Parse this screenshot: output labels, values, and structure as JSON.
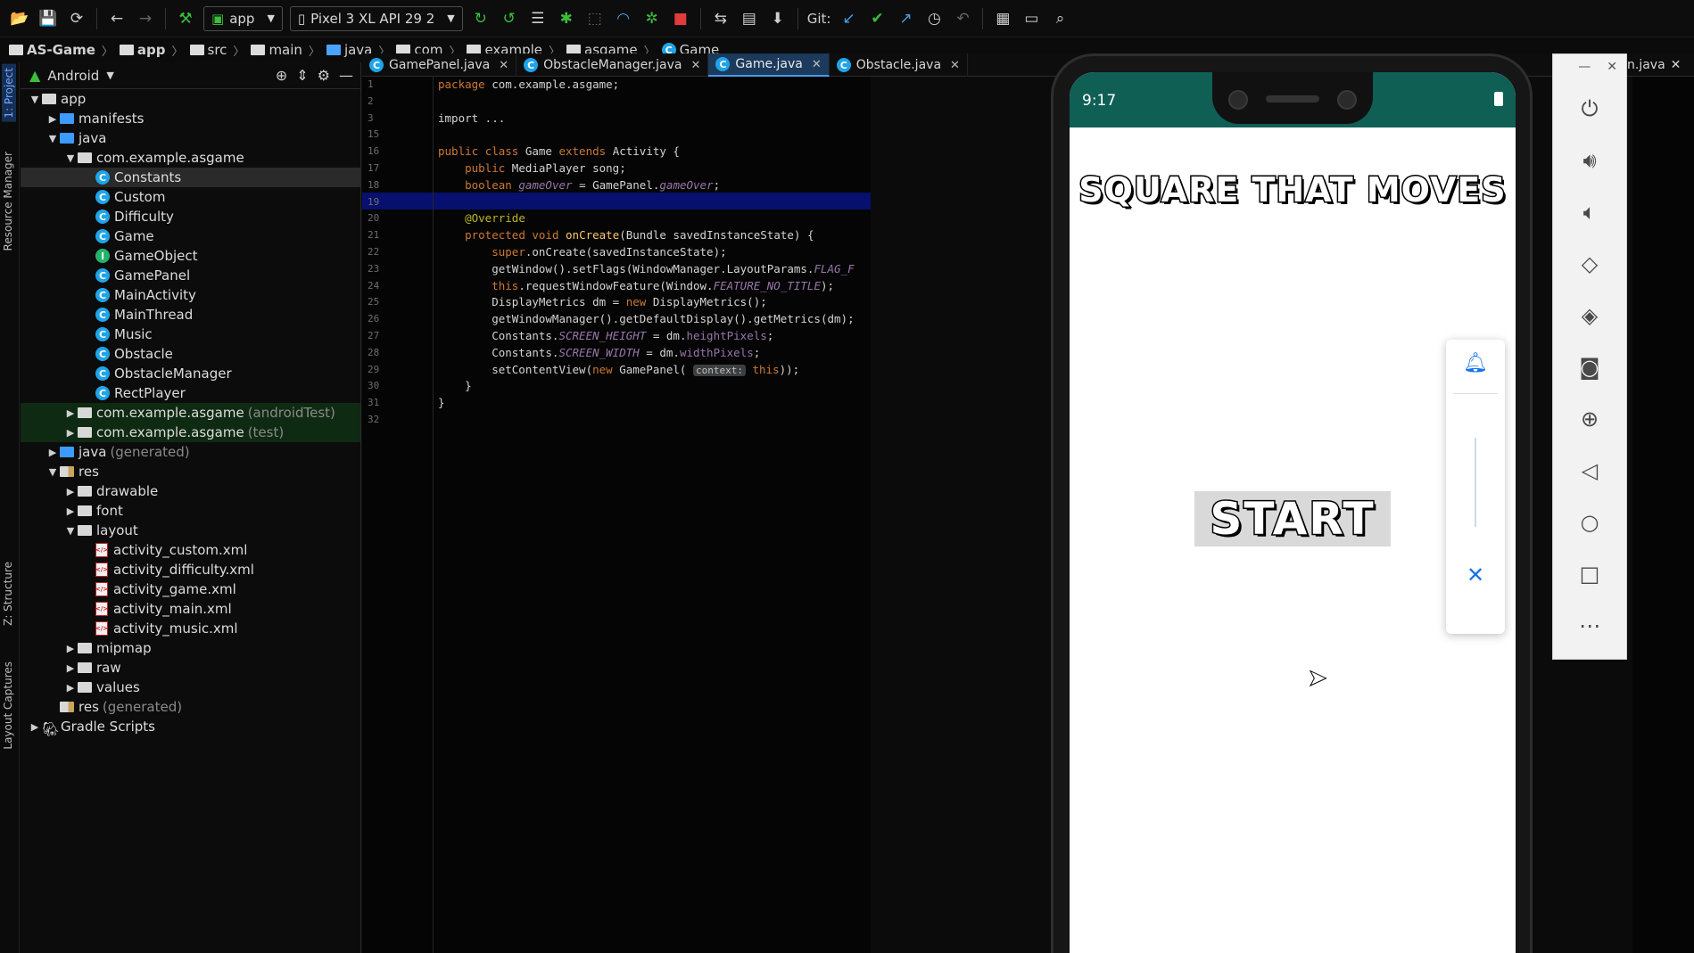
{
  "toolbar": {
    "run_config": "app",
    "device": "Pixel 3 XL API 29 2",
    "git_label": "Git:"
  },
  "breadcrumb": [
    "AS-Game",
    "app",
    "src",
    "main",
    "java",
    "com",
    "example",
    "asgame",
    "Game"
  ],
  "project_panel": {
    "view_mode": "Android",
    "tree": [
      {
        "label": "app",
        "depth": 0,
        "arrow": "▼",
        "icon": "app-folder"
      },
      {
        "label": "manifests",
        "depth": 1,
        "arrow": "▶",
        "icon": "folder-blue"
      },
      {
        "label": "java",
        "depth": 1,
        "arrow": "▼",
        "icon": "folder-blue"
      },
      {
        "label": "com.example.asgame",
        "depth": 2,
        "arrow": "▼",
        "icon": "package"
      },
      {
        "label": "Constants",
        "depth": 3,
        "icon": "class",
        "selected": true
      },
      {
        "label": "Custom",
        "depth": 3,
        "icon": "class"
      },
      {
        "label": "Difficulty",
        "depth": 3,
        "icon": "class"
      },
      {
        "label": "Game",
        "depth": 3,
        "icon": "class"
      },
      {
        "label": "GameObject",
        "depth": 3,
        "icon": "interface"
      },
      {
        "label": "GamePanel",
        "depth": 3,
        "icon": "class"
      },
      {
        "label": "MainActivity",
        "depth": 3,
        "icon": "class"
      },
      {
        "label": "MainThread",
        "depth": 3,
        "icon": "class"
      },
      {
        "label": "Music",
        "depth": 3,
        "icon": "class"
      },
      {
        "label": "Obstacle",
        "depth": 3,
        "icon": "class"
      },
      {
        "label": "ObstacleManager",
        "depth": 3,
        "icon": "class"
      },
      {
        "label": "RectPlayer",
        "depth": 3,
        "icon": "class"
      },
      {
        "label": "com.example.asgame",
        "suffix": "(androidTest)",
        "depth": 2,
        "arrow": "▶",
        "icon": "package",
        "green": true
      },
      {
        "label": "com.example.asgame",
        "suffix": "(test)",
        "depth": 2,
        "arrow": "▶",
        "icon": "package",
        "green": true
      },
      {
        "label": "java",
        "suffix": "(generated)",
        "depth": 1,
        "arrow": "▶",
        "icon": "folder-blue"
      },
      {
        "label": "res",
        "depth": 1,
        "arrow": "▼",
        "icon": "folder-res"
      },
      {
        "label": "drawable",
        "depth": 2,
        "arrow": "▶",
        "icon": "package"
      },
      {
        "label": "font",
        "depth": 2,
        "arrow": "▶",
        "icon": "package"
      },
      {
        "label": "layout",
        "depth": 2,
        "arrow": "▼",
        "icon": "package"
      },
      {
        "label": "activity_custom.xml",
        "depth": 3,
        "icon": "xml"
      },
      {
        "label": "activity_difficulty.xml",
        "depth": 3,
        "icon": "xml"
      },
      {
        "label": "activity_game.xml",
        "depth": 3,
        "icon": "xml"
      },
      {
        "label": "activity_main.xml",
        "depth": 3,
        "icon": "xml"
      },
      {
        "label": "activity_music.xml",
        "depth": 3,
        "icon": "xml"
      },
      {
        "label": "mipmap",
        "depth": 2,
        "arrow": "▶",
        "icon": "package"
      },
      {
        "label": "raw",
        "depth": 2,
        "arrow": "▶",
        "icon": "package"
      },
      {
        "label": "values",
        "depth": 2,
        "arrow": "▶",
        "icon": "package"
      },
      {
        "label": "res",
        "suffix": "(generated)",
        "depth": 1,
        "icon": "folder-res"
      },
      {
        "label": "Gradle Scripts",
        "depth": 0,
        "arrow": "▶",
        "icon": "gradle"
      }
    ]
  },
  "side_tabs": {
    "project": "1: Project",
    "resource_manager": "Resource Manager",
    "structure": "Z: Structure",
    "layout_captures": "Layout Captures"
  },
  "editor_tabs": [
    {
      "label": "GamePanel.java",
      "active": false
    },
    {
      "label": "ObstacleManager.java",
      "active": false
    },
    {
      "label": "Game.java",
      "active": true
    },
    {
      "label": "Obstacle.java",
      "active": false
    }
  ],
  "right_tab_label": "n.java",
  "code": {
    "line_numbers": [
      "1",
      "2",
      "3",
      "15",
      "16",
      "17",
      "18",
      "19",
      "20",
      "21",
      "22",
      "23",
      "24",
      "25",
      "26",
      "27",
      "28",
      "29",
      "30",
      "31",
      "32"
    ],
    "lines": [
      "package com.example.asgame;",
      "",
      "import ...",
      "",
      "public class Game extends Activity {",
      "    public MediaPlayer song;",
      "    boolean gameOver = GamePanel.gameOver;",
      "",
      "    @Override",
      "    protected void onCreate(Bundle savedInstanceState) {",
      "        super.onCreate(savedInstanceState);",
      "        getWindow().setFlags(WindowManager.LayoutParams.FLAG_F",
      "        this.requestWindowFeature(Window.FEATURE_NO_TITLE);",
      "        DisplayMetrics dm = new DisplayMetrics();",
      "        getWindowManager().getDefaultDisplay().getMetrics(dm);",
      "        Constants.SCREEN_HEIGHT = dm.heightPixels;",
      "        Constants.SCREEN_WIDTH = dm.widthPixels;",
      "        setContentView(new GamePanel( context: this));",
      "    }",
      "}",
      ""
    ]
  },
  "phone": {
    "time": "9:17",
    "game_title": "SQUARE THAT MOVES",
    "start_label": "START"
  },
  "colors": {
    "status_bar": "#0f5f55",
    "highlight_line": "#07106e",
    "active_tab": "#1b3a5c"
  }
}
